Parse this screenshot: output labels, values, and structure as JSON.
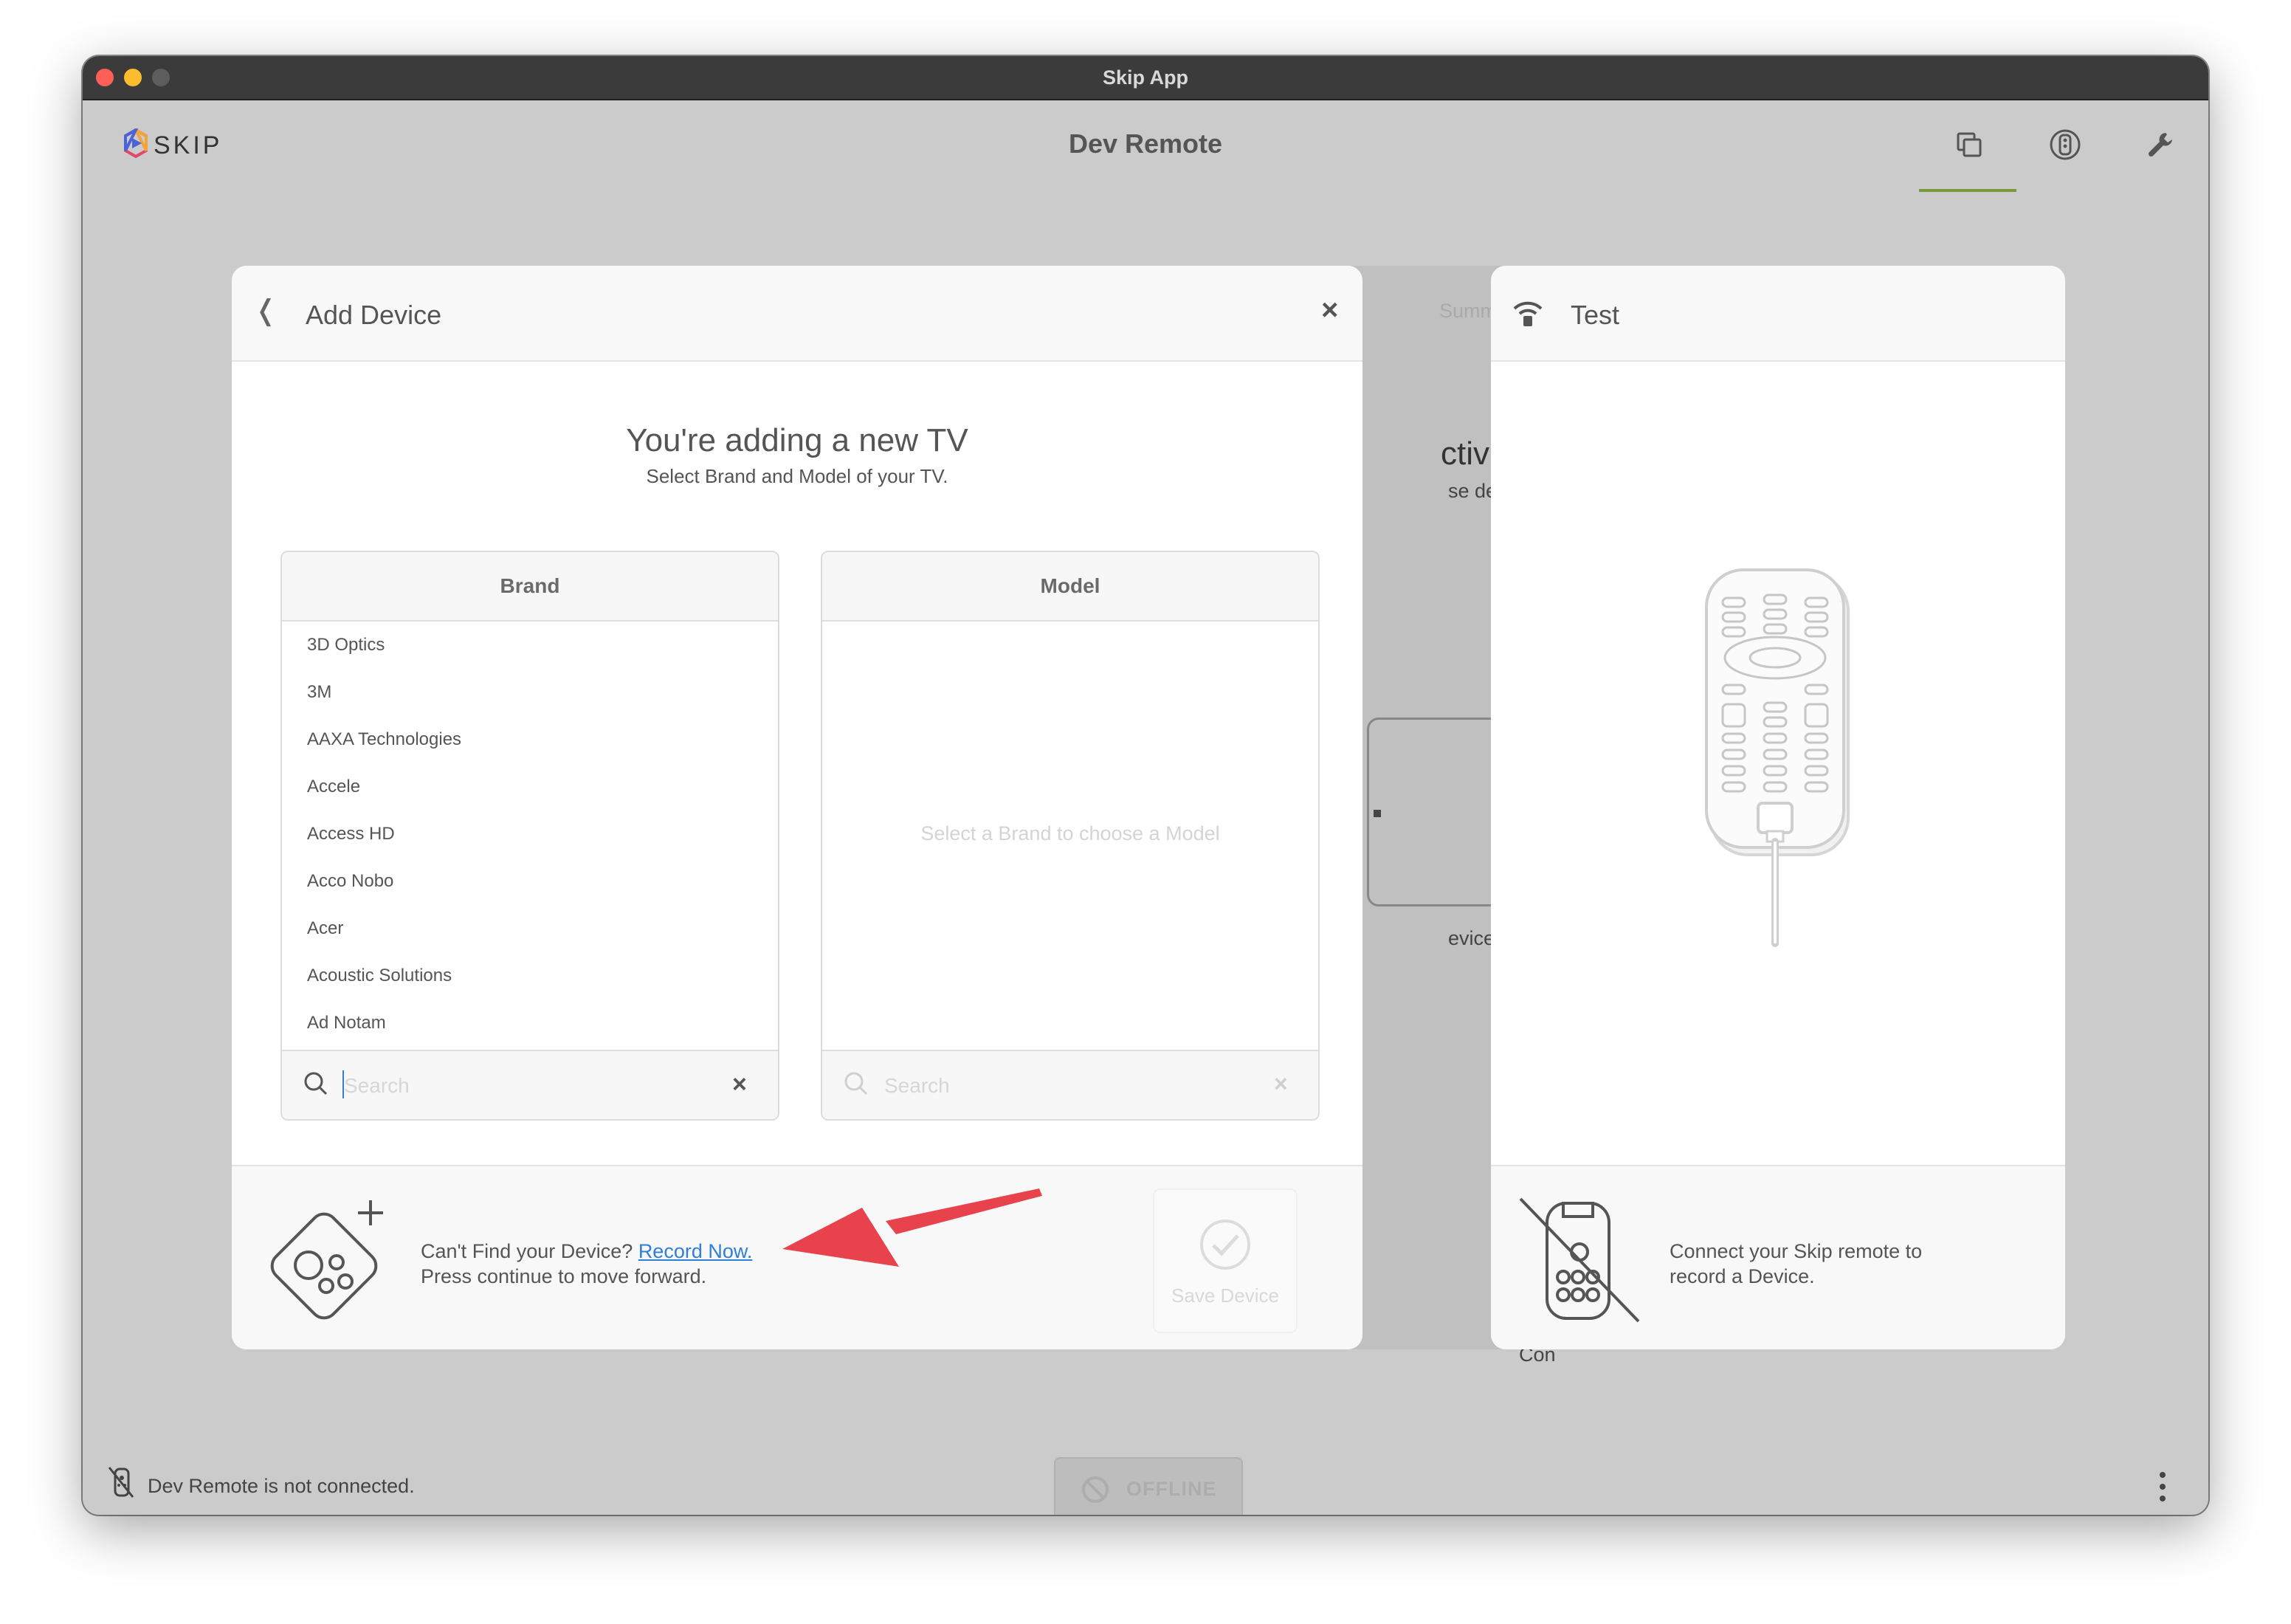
{
  "window": {
    "title": "Skip App"
  },
  "header": {
    "logo_text": "SKIP",
    "title": "Dev Remote"
  },
  "background_screen": {
    "tab_fragment": "Summ",
    "heading_fragment": "ctivity.",
    "sub_fragment": "se devices.",
    "device_fragment": "evice",
    "continue_fragment": "Con"
  },
  "add_device": {
    "back_label": "❬",
    "title": "Add Device",
    "close_label": "×",
    "heading": "You're adding a new TV",
    "subheading": "Select Brand and Model of your TV.",
    "brand": {
      "header": "Brand",
      "items": [
        "3D Optics",
        "3M",
        "AAXA Technologies",
        "Accele",
        "Access HD",
        "Acco Nobo",
        "Acer",
        "Acoustic Solutions",
        "Ad Notam"
      ],
      "search_placeholder": "Search",
      "search_value": "",
      "clear_label": "×"
    },
    "model": {
      "header": "Model",
      "empty_text": "Select a Brand to choose a Model",
      "search_placeholder": "Search",
      "clear_label": "×"
    },
    "footer": {
      "prompt": "Can't Find your Device?",
      "record_link": "Record Now.",
      "continue_text": "Press continue to move forward.",
      "save_label": "Save Device"
    }
  },
  "test_panel": {
    "title": "Test",
    "footer_text_line1": "Connect your Skip remote to",
    "footer_text_line2": "record a Device."
  },
  "statusbar": {
    "connection_text": "Dev Remote is not connected.",
    "offline_label": "OFFLINE"
  },
  "colors": {
    "accent": "#7a9a3a",
    "link": "#2f7fd8",
    "annotation_arrow": "#e8434c"
  }
}
